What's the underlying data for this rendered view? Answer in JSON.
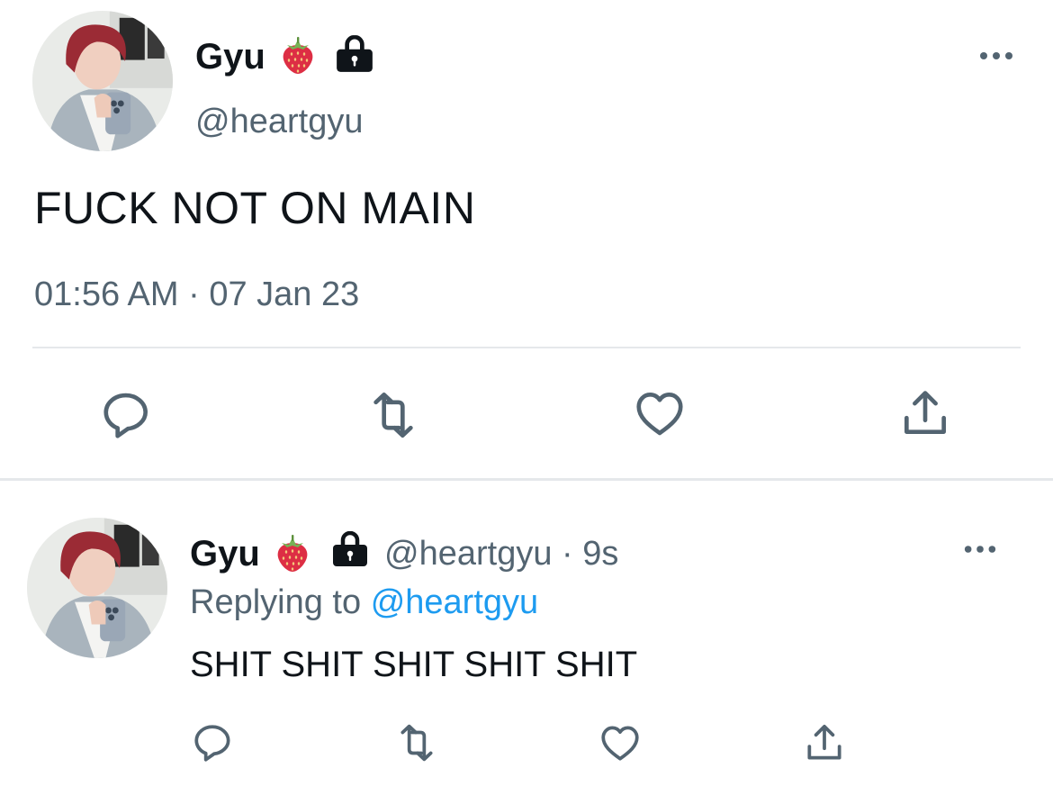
{
  "colors": {
    "text_primary": "#0f1419",
    "text_secondary": "#536471",
    "link": "#1d9bf0",
    "divider": "#e5e8eb",
    "icon": "#536471"
  },
  "main_tweet": {
    "display_name": "Gyu",
    "name_emoji": "strawberry-icon",
    "protected_icon": "lock-icon",
    "handle": "@heartgyu",
    "text": "FUCK NOT ON MAIN",
    "timestamp": "01:56 AM · 07 Jan 23",
    "actions": [
      "reply-icon",
      "retweet-icon",
      "like-icon",
      "share-icon"
    ]
  },
  "reply_tweet": {
    "display_name": "Gyu",
    "name_emoji": "strawberry-icon",
    "protected_icon": "lock-icon",
    "handle_time": "@heartgyu · 9s",
    "replying_prefix": "Replying to",
    "replying_mention": "@heartgyu",
    "text": "SHIT SHIT SHIT SHIT SHIT",
    "actions": [
      "reply-icon",
      "retweet-icon",
      "like-icon",
      "share-icon"
    ]
  }
}
